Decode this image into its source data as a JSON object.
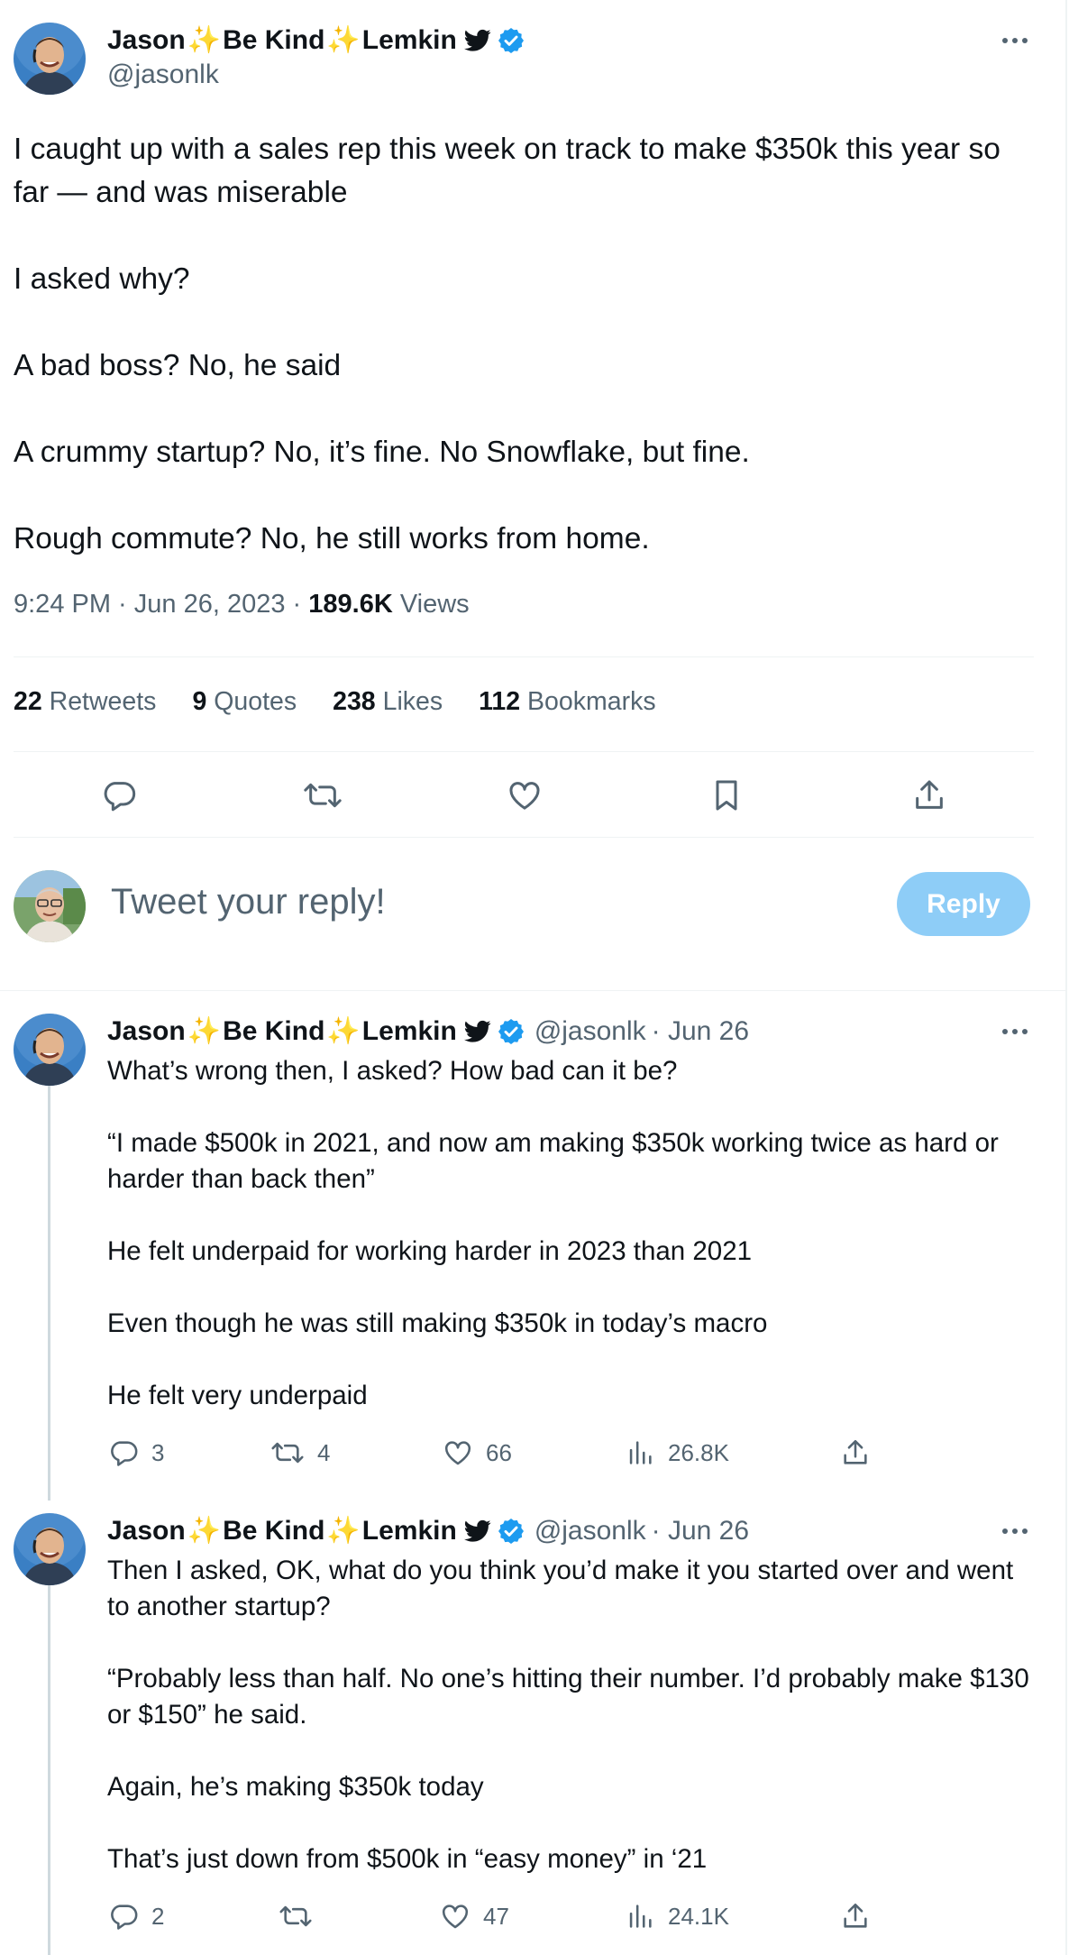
{
  "main_tweet": {
    "author_name_first": "Jason",
    "author_name_mid": "Be Kind",
    "author_name_last": "Lemkin",
    "spark": "✨",
    "handle": "@jasonlk",
    "lines": [
      "I caught up with a sales rep this week on track to make $350k this year so far — and was miserable",
      "I asked why?",
      "A bad boss?  No, he said",
      "A crummy startup?  No, it’s fine.  No Snowflake, but fine.",
      "Rough commute?  No, he still works from home."
    ],
    "timestamp": "9:24 PM · Jun 26, 2023 · ",
    "views_count": "189.6K",
    "views_label": "Views",
    "stats": {
      "retweets_count": "22",
      "retweets_label": "Retweets",
      "quotes_count": "9",
      "quotes_label": "Quotes",
      "likes_count": "238",
      "likes_label": "Likes",
      "bookmarks_count": "112",
      "bookmarks_label": "Bookmarks"
    }
  },
  "composer": {
    "placeholder": "Tweet your reply!",
    "reply_button": "Reply"
  },
  "replies": [
    {
      "author_name_first": "Jason",
      "author_name_mid": "Be Kind",
      "author_name_last": "Lemkin",
      "handle": "@jasonlk",
      "date": "· Jun 26",
      "lines": [
        "What’s wrong then, I asked?  How bad can it be?",
        "“I made $500k in 2021, and now am making $350k working twice as hard or harder than back then”",
        "He felt underpaid for working harder in 2023 than 2021",
        "Even though he was still making $350k in today’s macro",
        "He felt very underpaid"
      ],
      "replies": "3",
      "retweets": "4",
      "likes": "66",
      "views": "26.8K"
    },
    {
      "author_name_first": "Jason",
      "author_name_mid": "Be Kind",
      "author_name_last": "Lemkin",
      "handle": "@jasonlk",
      "date": "· Jun 26",
      "lines": [
        "Then I asked, OK, what do you think you’d make it you started over and went to another startup?",
        "“Probably less than half.  No one’s hitting their number.  I’d probably make $130 or $150” he said.",
        "Again, he’s making $350k today",
        "That’s just down from $500k in “easy money” in ‘21"
      ],
      "replies": "2",
      "retweets": "",
      "likes": "47",
      "views": "24.1K"
    }
  ],
  "colors": {
    "text": "#0f1419",
    "secondary": "#536471",
    "accent": "#1d9bf0",
    "reply_button_disabled": "#8ecdf7",
    "divider": "#eff3f4",
    "thread_line": "#cfd9de"
  }
}
